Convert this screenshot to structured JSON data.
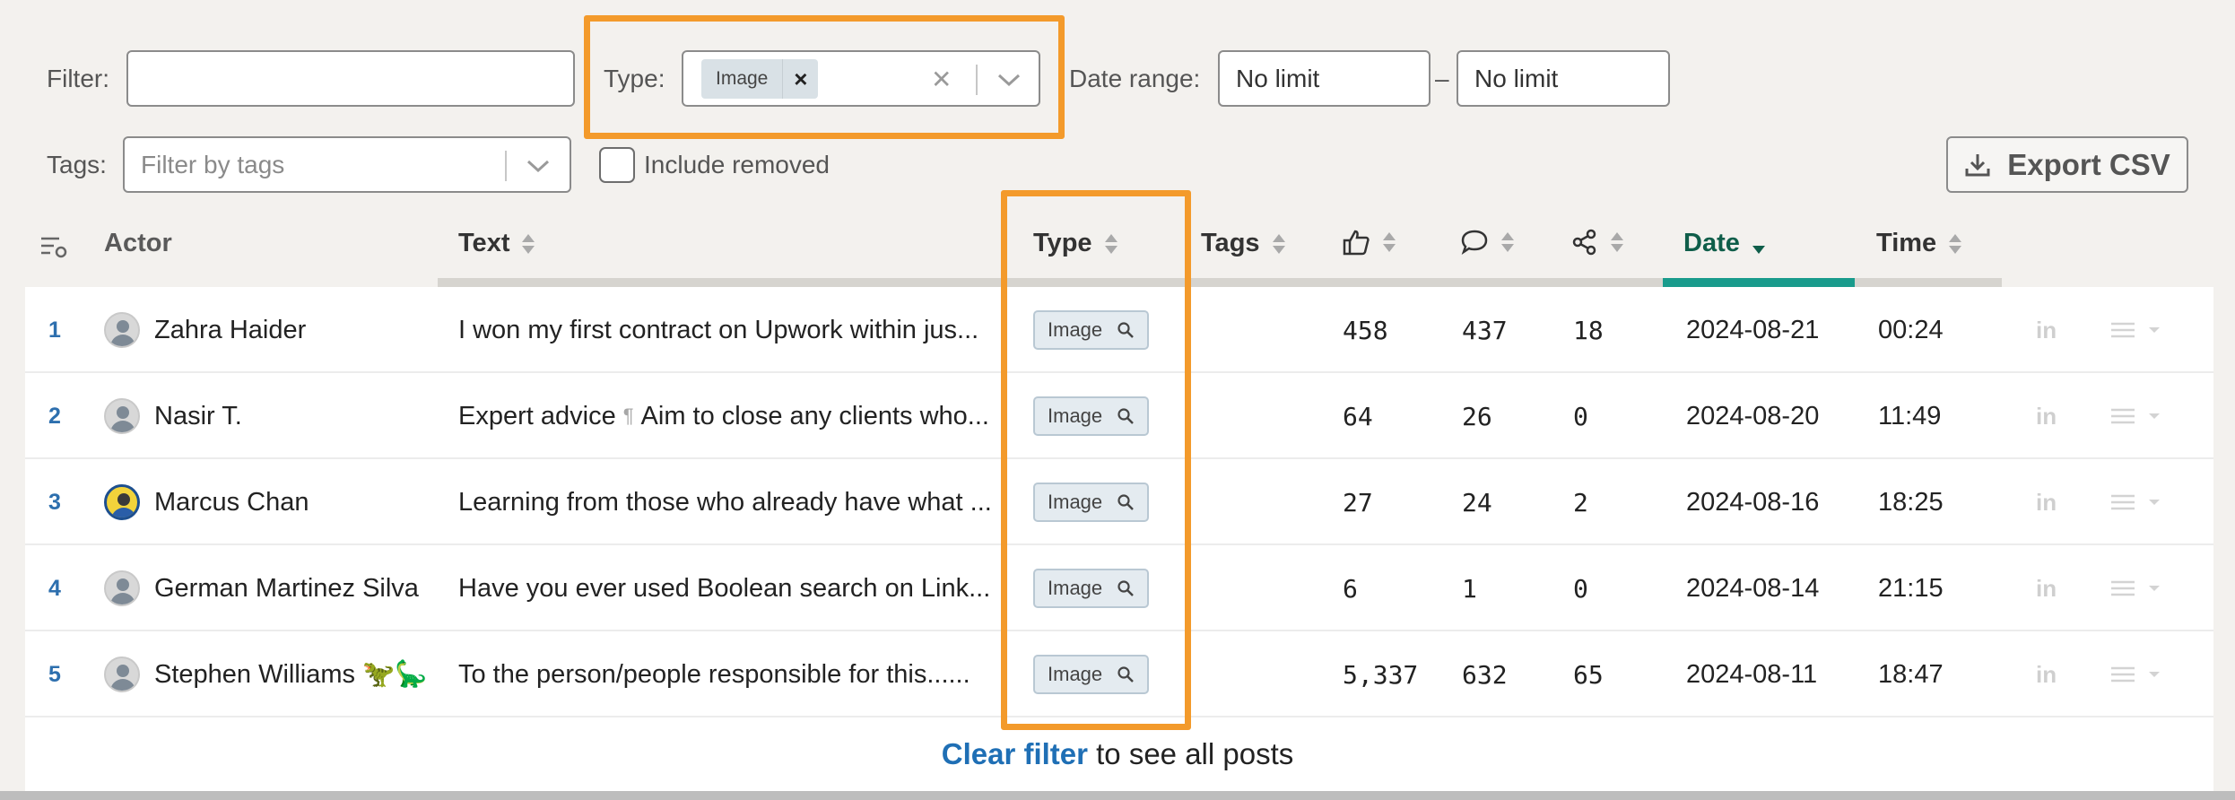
{
  "filters": {
    "filter_label": "Filter:",
    "filter_value": "",
    "type_label": "Type:",
    "type_chip": "Image",
    "type_chip_remove": "×",
    "type_clear": "✕",
    "date_label": "Date range:",
    "date_from": "No limit",
    "date_sep": "–",
    "date_to": "No limit",
    "tags_label": "Tags:",
    "tags_placeholder": "Filter by tags",
    "include_removed": "Include removed",
    "export_label": "Export CSV"
  },
  "columns": {
    "actor": "Actor",
    "text": "Text",
    "type": "Type",
    "tags": "Tags",
    "date": "Date",
    "time": "Time"
  },
  "rows": [
    {
      "num": "1",
      "actor": "Zahra Haider",
      "text": "I won my first contract on Upwork within jus...",
      "type": "Image",
      "likes": "458",
      "comments": "437",
      "shares": "18",
      "date": "2024-08-21",
      "time": "00:24"
    },
    {
      "num": "2",
      "actor": "Nasir T.",
      "text_a": "Expert advice",
      "text_pil": "¶",
      "text_b": "Aim to close any clients who...",
      "type": "Image",
      "likes": "64",
      "comments": "26",
      "shares": "0",
      "date": "2024-08-20",
      "time": "11:49"
    },
    {
      "num": "3",
      "actor": "Marcus Chan",
      "text": "Learning from those who already have what ...",
      "type": "Image",
      "likes": "27",
      "comments": "24",
      "shares": "2",
      "date": "2024-08-16",
      "time": "18:25"
    },
    {
      "num": "4",
      "actor": "German Martinez Silva",
      "text": "Have you ever used Boolean search on Link...",
      "type": "Image",
      "likes": "6",
      "comments": "1",
      "shares": "0",
      "date": "2024-08-14",
      "time": "21:15"
    },
    {
      "num": "5",
      "actor": "Stephen Williams 🦖🦕",
      "text": "To the person/people responsible for this......",
      "type": "Image",
      "likes": "5,337",
      "comments": "632",
      "shares": "65",
      "date": "2024-08-11",
      "time": "18:47"
    }
  ],
  "footer": {
    "clear_link": "Clear filter",
    "clear_rest": " to see all posts"
  },
  "colors": {
    "highlight": "#f39a2b",
    "accent": "#0f5e4a",
    "link": "#1f6fb5"
  }
}
